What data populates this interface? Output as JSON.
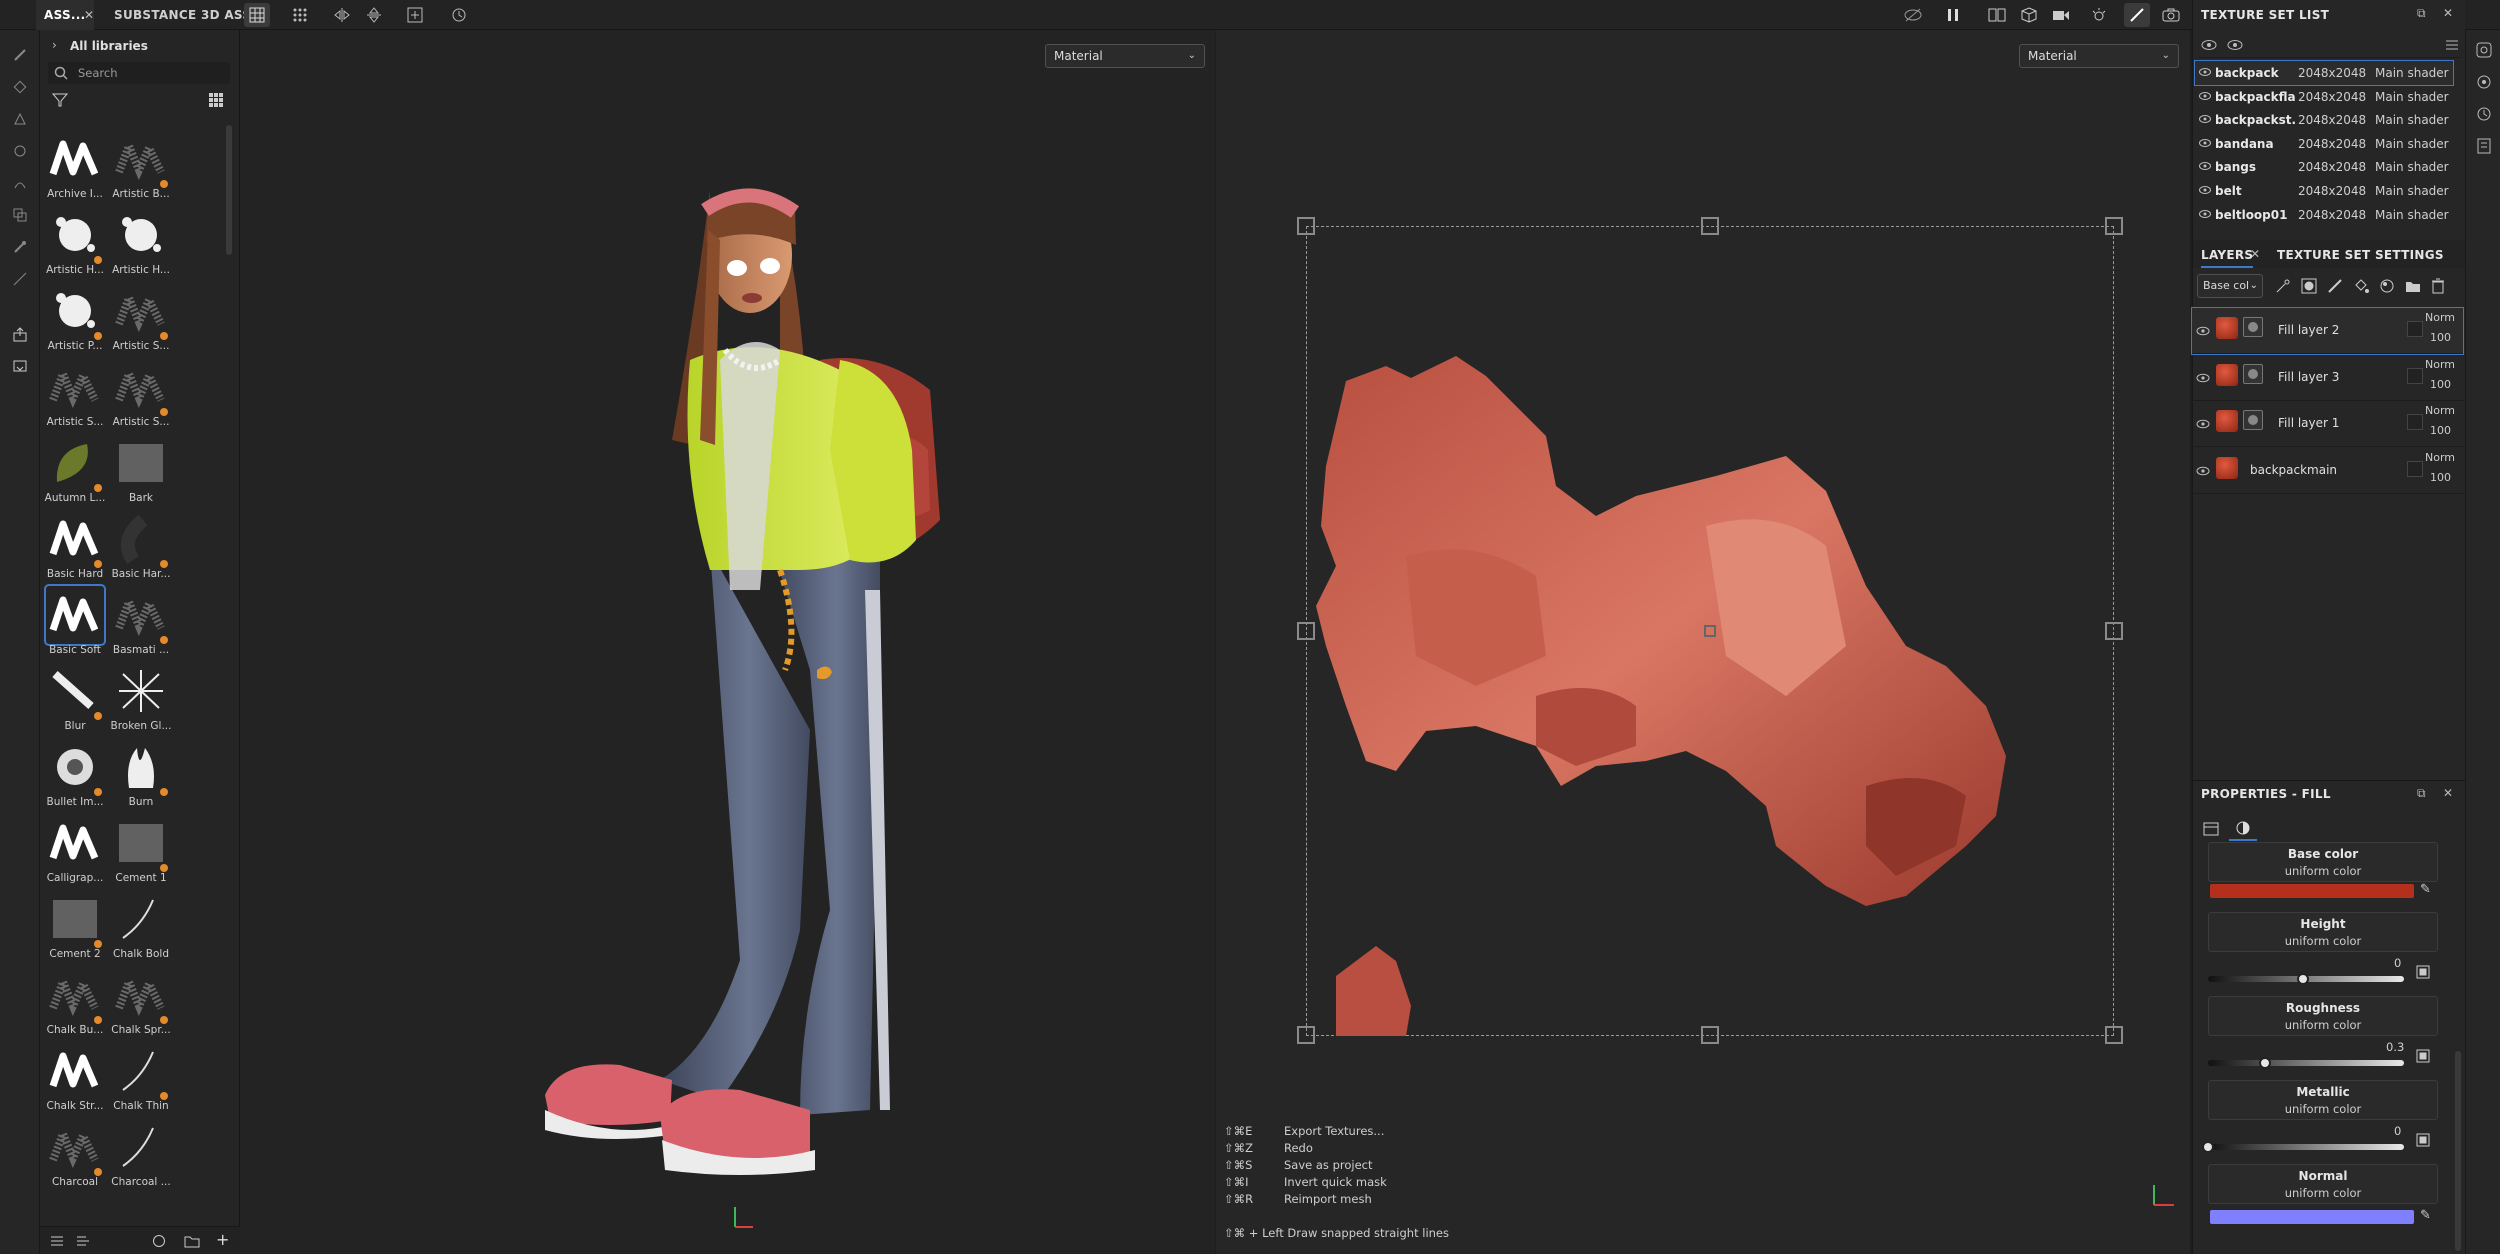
{
  "tabs": [
    {
      "label": "ASS..."
    },
    {
      "label": "SUBSTANCE 3D ASS..."
    }
  ],
  "assets": {
    "breadcrumb": "All libraries",
    "search_placeholder": "Search",
    "items": [
      {
        "label": "Archive I..."
      },
      {
        "label": "Artistic B..."
      },
      {
        "label": "Artistic H..."
      },
      {
        "label": "Artistic H..."
      },
      {
        "label": "Artistic P..."
      },
      {
        "label": "Artistic S..."
      },
      {
        "label": "Artistic S..."
      },
      {
        "label": "Artistic S..."
      },
      {
        "label": "Autumn L..."
      },
      {
        "label": "Bark"
      },
      {
        "label": "Basic Hard"
      },
      {
        "label": "Basic Har..."
      },
      {
        "label": "Basic Soft"
      },
      {
        "label": "Basmati ..."
      },
      {
        "label": "Blur"
      },
      {
        "label": "Broken Gl..."
      },
      {
        "label": "Bullet Im..."
      },
      {
        "label": "Burn"
      },
      {
        "label": "Calligrap..."
      },
      {
        "label": "Cement 1"
      },
      {
        "label": "Cement 2"
      },
      {
        "label": "Chalk Bold"
      },
      {
        "label": "Chalk Bu..."
      },
      {
        "label": "Chalk Spr..."
      },
      {
        "label": "Chalk Str..."
      },
      {
        "label": "Chalk Thin"
      },
      {
        "label": "Charcoal"
      },
      {
        "label": "Charcoal ..."
      }
    ]
  },
  "viewport3d": {
    "mode": "Material"
  },
  "viewport2d": {
    "mode": "Material"
  },
  "shortcuts": [
    {
      "keys": "⇧⌘E",
      "action": "Export Textures..."
    },
    {
      "keys": "⇧⌘Z",
      "action": "Redo"
    },
    {
      "keys": "⇧⌘S",
      "action": "Save as project"
    },
    {
      "keys": "⇧⌘I",
      "action": "Invert quick mask"
    },
    {
      "keys": "⇧⌘R",
      "action": "Reimport mesh"
    }
  ],
  "status_hint": "⇧⌘ + Left  Draw snapped straight lines",
  "texture_set_list": {
    "title": "TEXTURE SET LIST",
    "rows": [
      {
        "name": "backpack",
        "res": "2048x2048",
        "shader": "Main shader"
      },
      {
        "name": "backpackflap",
        "res": "2048x2048",
        "shader": "Main shader"
      },
      {
        "name": "backpackst...",
        "res": "2048x2048",
        "shader": "Main shader"
      },
      {
        "name": "bandana",
        "res": "2048x2048",
        "shader": "Main shader"
      },
      {
        "name": "bangs",
        "res": "2048x2048",
        "shader": "Main shader"
      },
      {
        "name": "belt",
        "res": "2048x2048",
        "shader": "Main shader"
      },
      {
        "name": "beltloop01",
        "res": "2048x2048",
        "shader": "Main shader"
      }
    ]
  },
  "layers_panel": {
    "tab_layers": "LAYERS",
    "tab_settings": "TEXTURE SET SETTINGS",
    "channel": "Base col",
    "layers": [
      {
        "name": "Fill layer 2",
        "blend": "Norm",
        "opacity": "100"
      },
      {
        "name": "Fill layer 3",
        "blend": "Norm",
        "opacity": "100"
      },
      {
        "name": "Fill layer 1",
        "blend": "Norm",
        "opacity": "100"
      },
      {
        "name": "backpackmain",
        "blend": "Norm",
        "opacity": "100"
      }
    ]
  },
  "properties": {
    "title": "PROPERTIES - FILL",
    "base_color": {
      "label": "Base color",
      "sub": "uniform color",
      "color": "#b5301c"
    },
    "height": {
      "label": "Height",
      "sub": "uniform color",
      "value": "0",
      "fraction": 0.5
    },
    "roughness": {
      "label": "Roughness",
      "sub": "uniform color",
      "value": "0.3",
      "fraction": 0.3
    },
    "metallic": {
      "label": "Metallic",
      "sub": "uniform color",
      "value": "0",
      "fraction": 0.0
    },
    "normal": {
      "label": "Normal",
      "sub": "uniform color",
      "color": "#8080ff"
    }
  },
  "colors": {
    "accent": "#3c79c8",
    "pin": "#e58a2a",
    "mesh": "#c9604e"
  }
}
